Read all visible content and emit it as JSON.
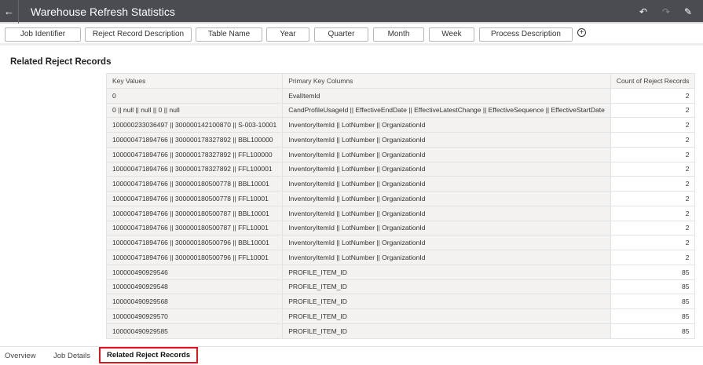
{
  "header": {
    "title": "Warehouse Refresh Statistics",
    "icons": [
      "back-arrow-icon",
      "undo-icon",
      "redo-icon",
      "edit-icon"
    ]
  },
  "filters": [
    "Job Identifier",
    "Reject Record Description",
    "Table Name",
    "Year",
    "Quarter",
    "Month",
    "Week",
    "Process Description"
  ],
  "section_title": "Related Reject Records",
  "table": {
    "columns": [
      "Key Values",
      "Primary Key Columns",
      "Count of Reject Records"
    ],
    "rows": [
      [
        "0",
        "EvalItemId",
        "2"
      ],
      [
        "0 || null || null || 0 || null",
        "CandProfileUsageId || EffectiveEndDate || EffectiveLatestChange || EffectiveSequence || EffectiveStartDate",
        "2"
      ],
      [
        "100000233036497 || 300000142100870 || S-003-10001",
        "InventoryItemId || LotNumber || OrganizationId",
        "2"
      ],
      [
        "100000471894766 || 300000178327892 || BBL100000",
        "InventoryItemId || LotNumber || OrganizationId",
        "2"
      ],
      [
        "100000471894766 || 300000178327892 || FFL100000",
        "InventoryItemId || LotNumber || OrganizationId",
        "2"
      ],
      [
        "100000471894766 || 300000178327892 || FFL100001",
        "InventoryItemId || LotNumber || OrganizationId",
        "2"
      ],
      [
        "100000471894766 || 300000180500778 || BBL10001",
        "InventoryItemId || LotNumber || OrganizationId",
        "2"
      ],
      [
        "100000471894766 || 300000180500778 || FFL10001",
        "InventoryItemId || LotNumber || OrganizationId",
        "2"
      ],
      [
        "100000471894766 || 300000180500787 || BBL10001",
        "InventoryItemId || LotNumber || OrganizationId",
        "2"
      ],
      [
        "100000471894766 || 300000180500787 || FFL10001",
        "InventoryItemId || LotNumber || OrganizationId",
        "2"
      ],
      [
        "100000471894766 || 300000180500796 || BBL10001",
        "InventoryItemId || LotNumber || OrganizationId",
        "2"
      ],
      [
        "100000471894766 || 300000180500796 || FFL10001",
        "InventoryItemId || LotNumber || OrganizationId",
        "2"
      ],
      [
        "100000490929546",
        "PROFILE_ITEM_ID",
        "85"
      ],
      [
        "100000490929548",
        "PROFILE_ITEM_ID",
        "85"
      ],
      [
        "100000490929568",
        "PROFILE_ITEM_ID",
        "85"
      ],
      [
        "100000490929570",
        "PROFILE_ITEM_ID",
        "85"
      ],
      [
        "100000490929585",
        "PROFILE_ITEM_ID",
        "85"
      ]
    ]
  },
  "tabs": [
    {
      "label": "Overview"
    },
    {
      "label": "Job Details"
    },
    {
      "label": "Related Reject Records",
      "active": true
    }
  ],
  "colors": {
    "header_bg": "#4a4c51",
    "active_tab_highlight": "#e3141e"
  }
}
